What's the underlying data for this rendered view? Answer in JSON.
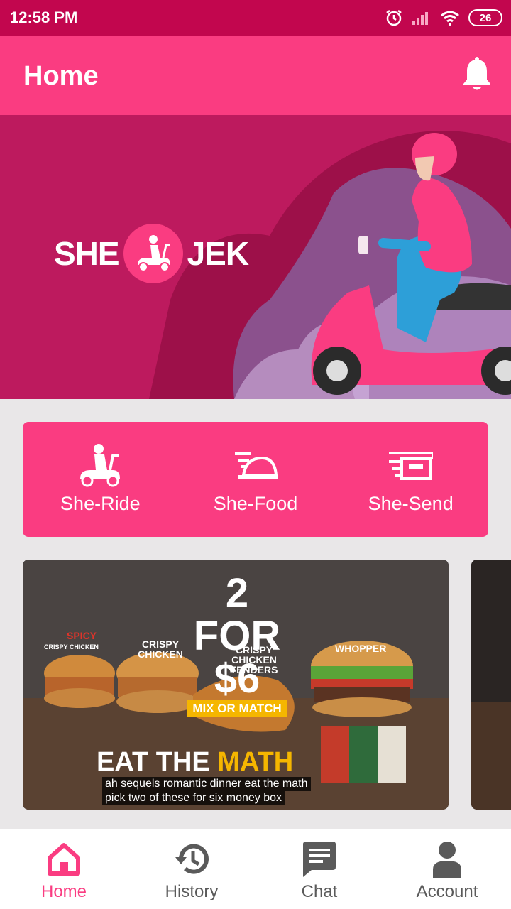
{
  "status": {
    "time": "12:58 PM",
    "battery": "26"
  },
  "appbar": {
    "title": "Home"
  },
  "banner": {
    "brand_left": "SHE",
    "brand_right": "JEK"
  },
  "services": [
    {
      "label": "She-Ride",
      "icon": "scooter-icon"
    },
    {
      "label": "She-Food",
      "icon": "food-cloche-icon"
    },
    {
      "label": "She-Send",
      "icon": "delivery-box-icon"
    }
  ],
  "promo": {
    "headline_big": "2 FOR",
    "headline_price": "$6",
    "headline_tag": "MIX OR MATCH",
    "items": [
      "SPICY",
      "CRISPY CHICKEN",
      "CRISPY CHICKEN",
      "CRISPY CHICKEN TENDERS",
      "WHOPPER"
    ],
    "tagline_white": "EAT THE",
    "tagline_yellow": "MATH",
    "caption_line1": "ah sequels romantic dinner eat the math",
    "caption_line2": "pick two of these for six money box"
  },
  "nav": [
    {
      "label": "Home",
      "icon": "home-icon",
      "active": true
    },
    {
      "label": "History",
      "icon": "history-icon",
      "active": false
    },
    {
      "label": "Chat",
      "icon": "chat-icon",
      "active": false
    },
    {
      "label": "Account",
      "icon": "account-icon",
      "active": false
    }
  ],
  "colors": {
    "primary": "#fa3c81",
    "status_bar": "#c2064e",
    "banner": "#bd1a5e",
    "accent_yellow": "#f5b600"
  }
}
